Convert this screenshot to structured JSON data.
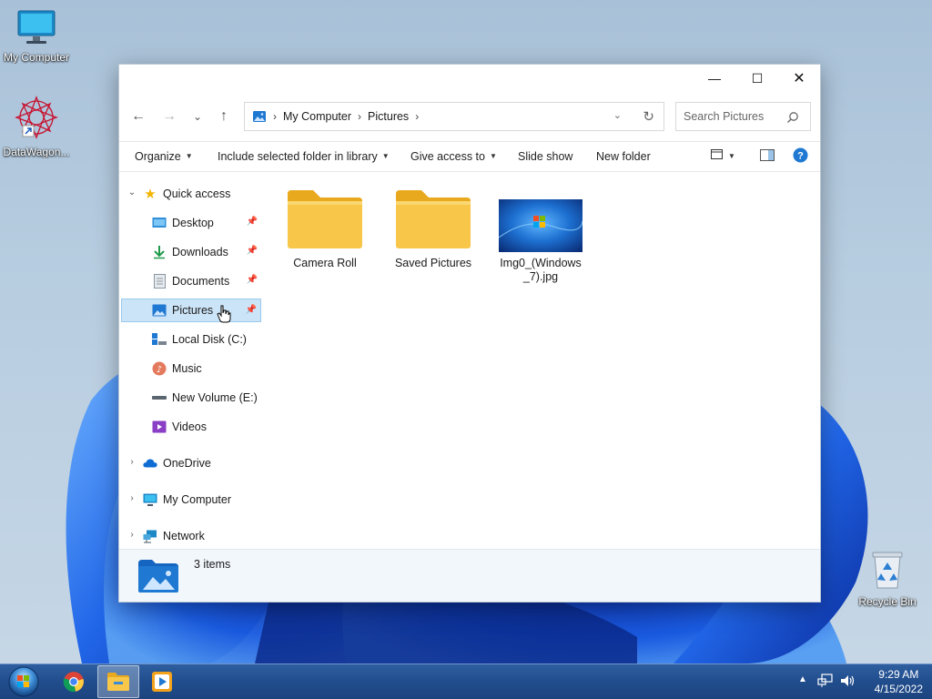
{
  "desktop": {
    "icons": [
      {
        "label": "My Computer"
      },
      {
        "label": "DataWagon..."
      },
      {
        "label": "Recycle Bin"
      }
    ]
  },
  "window": {
    "titlebar": {
      "minimize": "—",
      "maximize": "☐",
      "close": "✕"
    },
    "nav": {
      "back": "←",
      "forward": "→",
      "recent": "⌄",
      "up": "↑"
    },
    "address": {
      "crumbs": [
        "My Computer",
        "Pictures"
      ]
    },
    "search": {
      "placeholder": "Search Pictures"
    },
    "commands": {
      "organize": "Organize",
      "include": "Include selected folder in library",
      "share": "Give access to",
      "slideshow": "Slide show",
      "new_folder": "New folder"
    },
    "navpane": {
      "quick_access": "Quick access",
      "items": [
        "Desktop",
        "Downloads",
        "Documents",
        "Pictures",
        "Local Disk (C:)",
        "Music",
        "New Volume (E:)",
        "Videos"
      ],
      "onedrive": "OneDrive",
      "my_computer": "My Computer",
      "network": "Network"
    },
    "files": [
      {
        "name": "Camera Roll",
        "icon": "folder-icon"
      },
      {
        "name": "Saved Pictures",
        "icon": "folder-icon"
      },
      {
        "name": "Img0_(Windows_7).jpg",
        "icon": "image-thumbnail"
      }
    ],
    "status": {
      "count": "3 items"
    }
  },
  "taskbar": {
    "time": "9:29 AM",
    "date": "4/15/2022"
  },
  "colors": {
    "accent": "#0067c0",
    "selection": "#cce4f7",
    "taskbar": "#214d8c",
    "folder": "#f8c74a"
  }
}
